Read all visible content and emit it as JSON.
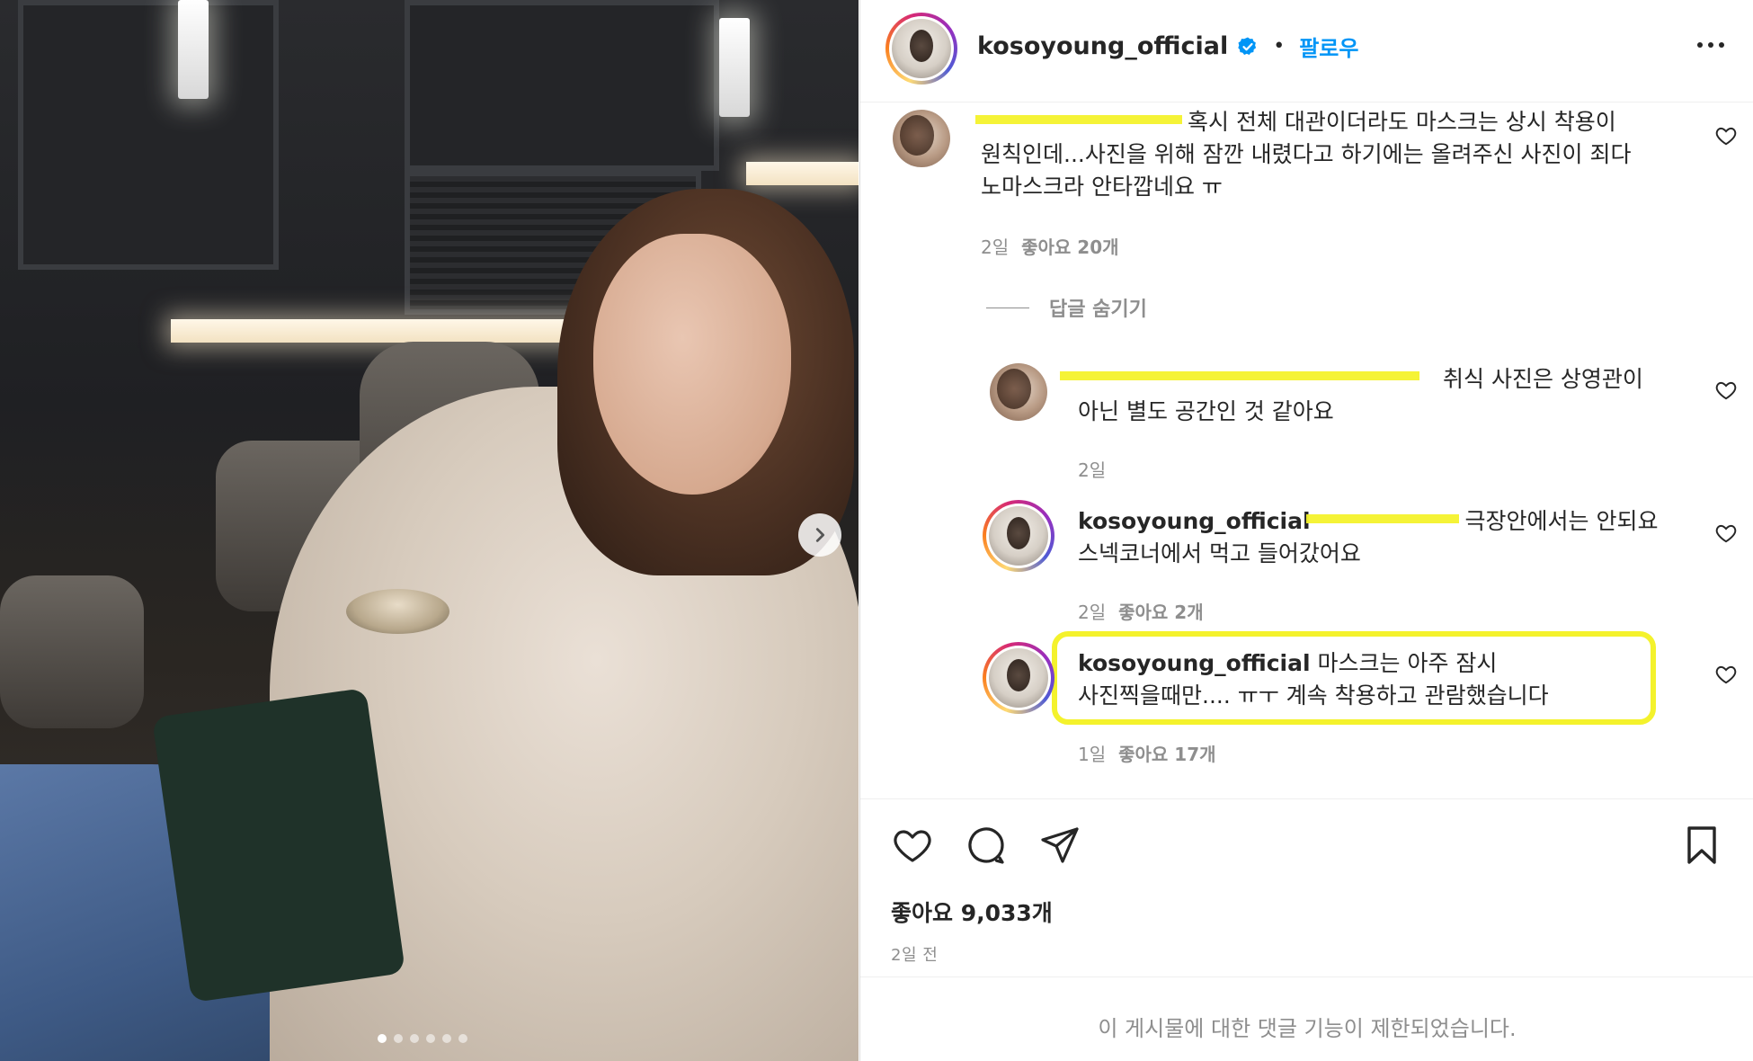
{
  "post": {
    "username": "kosoyoung_official",
    "separator": "•",
    "follow_label": "팔로우",
    "more_icon": "more-horizontal-icon",
    "likes_total": "좋아요 9,033개",
    "time_ago": "2일 전",
    "comments_restricted": "이 게시물에 대한 댓글 기능이 제한되었습니다.",
    "carousel": {
      "slide_count": 6,
      "active_index": 0,
      "next_icon": "chevron-right-icon"
    }
  },
  "comments": [
    {
      "text": "혹시 전체 대관이더라도 마스크는 상시 착용이 원칙인데...사진을 위해 잠깐 내렸다고 하기에는 올려주신 사진이 죄다 노마스크라 안타깝네요 ㅠ",
      "time": "2일",
      "likes": "좋아요 20개",
      "heart_icon": "heart-outline-icon"
    }
  ],
  "hide_replies_label": "답글 숨기기",
  "replies": [
    {
      "text": "취식 사진은 상영관이 아닌 별도 공간인 것 같아요",
      "time": "2일",
      "likes": "",
      "heart_icon": "heart-outline-icon"
    },
    {
      "username": "kosoyoung_official",
      "text": "극장안에서는 안되요 스넥코너에서 먹고 들어갔어요",
      "time": "2일",
      "likes": "좋아요 2개",
      "heart_icon": "heart-outline-icon"
    },
    {
      "username": "kosoyoung_official",
      "text": "마스크는 아주 잠시 사진찍을때만.... ㅠㅜ 계속 착용하고 관람했습니다",
      "time": "1일",
      "likes": "좋아요 17개",
      "heart_icon": "heart-outline-icon",
      "highlighted": true
    }
  ],
  "action_icons": [
    "heart-outline-icon",
    "comment-icon",
    "share-icon",
    "bookmark-icon"
  ],
  "colors": {
    "link_blue": "#0095f6",
    "verified_blue": "#0095f6",
    "highlight_yellow": "#f4f22c",
    "muted_text": "#8e8e8e",
    "primary_text": "#262626"
  }
}
